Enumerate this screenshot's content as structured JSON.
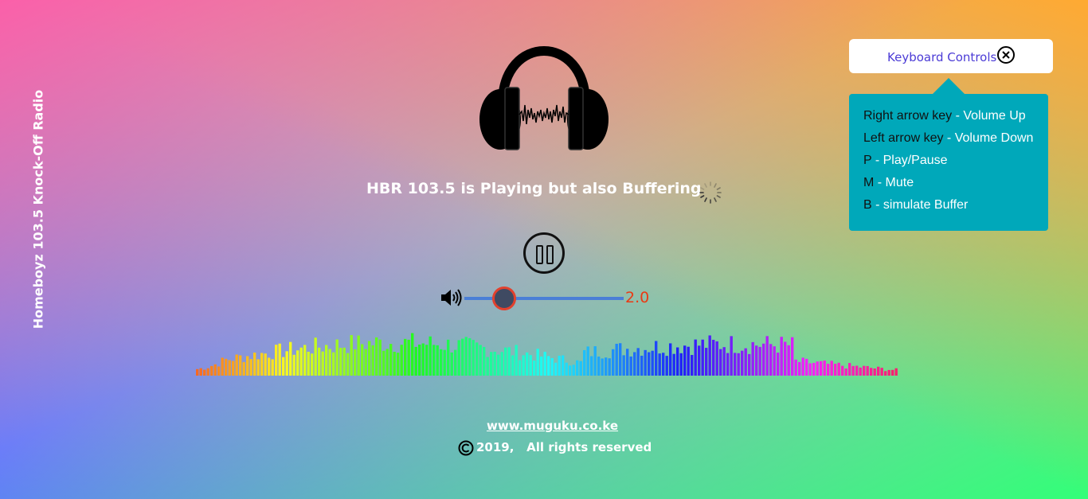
{
  "sidebar": {
    "title": "Homeboyz 103.5 Knock-Off Radio"
  },
  "player": {
    "status_text": "HBR 103.5 is Playing but also Buffering",
    "volume_value": "2.0",
    "volume_level": 0.25,
    "is_playing": true
  },
  "footer": {
    "link_text": "www.muguku.co.ke",
    "copyright_text": "2019,   All rights reserved"
  },
  "keyboard_controls": {
    "button_label": "Keyboard Controls",
    "items": [
      {
        "key": "Right arrow key",
        "desc": " - Volume Up"
      },
      {
        "key": "Left arrow key",
        "desc": " - Volume Down"
      },
      {
        "key": "P",
        "desc": " - Play/Pause"
      },
      {
        "key": "M",
        "desc": " - Mute"
      },
      {
        "key": "B",
        "desc": " - simulate Buffer"
      }
    ]
  },
  "icons": {
    "headphones": "headphones-icon",
    "spinner": "loading-spinner-icon",
    "pause": "pause-icon",
    "volume": "volume-icon",
    "close": "close-circle-icon",
    "copyright": "copyright-icon"
  },
  "colors": {
    "accent_panel": "#00a8ba",
    "volume_value": "#ea3a14",
    "link_blue": "#4b3bd6",
    "slider_track": "#4a7fd6",
    "slider_thumb_border": "#e2412e"
  }
}
